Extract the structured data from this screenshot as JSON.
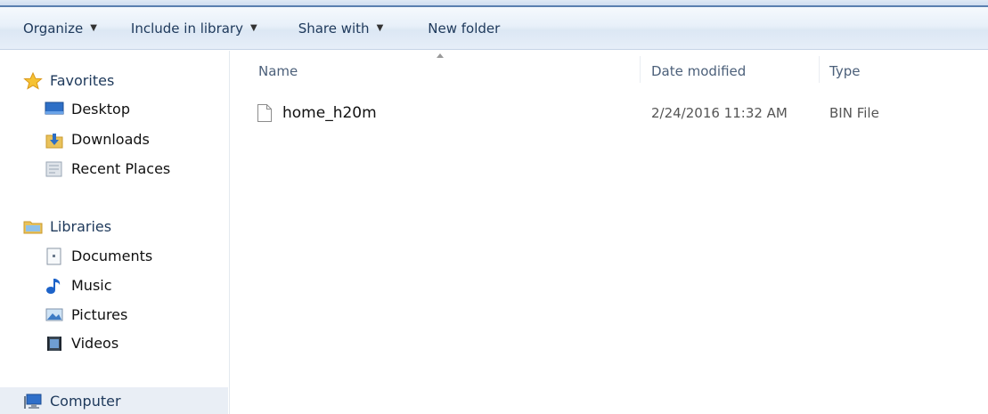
{
  "toolbar": {
    "organize": "Organize",
    "include_in_library": "Include in library",
    "share_with": "Share with",
    "new_folder": "New folder",
    "dropdown_glyph": "▼"
  },
  "nav": {
    "favorites": {
      "label": "Favorites",
      "items": [
        {
          "label": "Desktop",
          "icon": "desktop-icon"
        },
        {
          "label": "Downloads",
          "icon": "downloads-icon"
        },
        {
          "label": "Recent Places",
          "icon": "recent-places-icon"
        }
      ]
    },
    "libraries": {
      "label": "Libraries",
      "items": [
        {
          "label": "Documents",
          "icon": "documents-icon"
        },
        {
          "label": "Music",
          "icon": "music-icon"
        },
        {
          "label": "Pictures",
          "icon": "pictures-icon"
        },
        {
          "label": "Videos",
          "icon": "videos-icon"
        }
      ]
    },
    "computer": {
      "label": "Computer"
    }
  },
  "columns": {
    "name": "Name",
    "date_modified": "Date modified",
    "type": "Type"
  },
  "files": [
    {
      "name": "home_h20m",
      "date_modified": "2/24/2016 11:32 AM",
      "type": "BIN File"
    }
  ],
  "colors": {
    "toolbar_text": "#1e395b",
    "header_text": "#4c607a",
    "selection_bg": "#e9eef5"
  }
}
